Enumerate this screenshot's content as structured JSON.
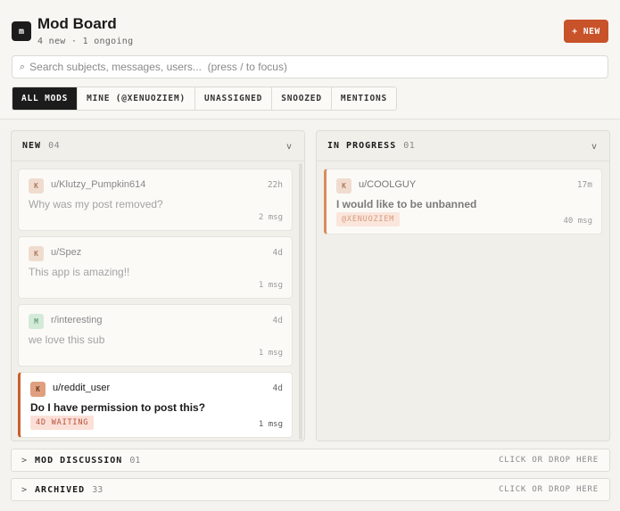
{
  "header": {
    "logo": "m",
    "title": "Mod Board",
    "subtitle": "4 new · 1 ongoing",
    "new_button": "+ NEW"
  },
  "search": {
    "icon": "search-icon",
    "placeholder": "Search subjects, messages, users...  (press / to focus)"
  },
  "filters": [
    "ALL MODS",
    "MINE (@XENUOZIEM)",
    "UNASSIGNED",
    "SNOOZED",
    "MENTIONS"
  ],
  "columns": {
    "new": {
      "title": "NEW",
      "count": "04",
      "chevron": "v",
      "cards": [
        {
          "avatar": "K",
          "author": "u/Klutzy_Pumpkin614",
          "age": "22h",
          "subject": "Why was my post removed?",
          "msgs": "2 msg"
        },
        {
          "avatar": "K",
          "author": "u/Spez",
          "age": "4d",
          "subject": "This app is amazing!!",
          "msgs": "1 msg"
        },
        {
          "avatar": "M",
          "author": "r/interesting",
          "age": "4d",
          "subject": "we love this sub",
          "msgs": "1 msg"
        },
        {
          "avatar": "K",
          "author": "u/reddit_user",
          "age": "4d",
          "subject": "Do I have permission to post this?",
          "msgs": "1 msg",
          "badge": "4D WAITING"
        }
      ]
    },
    "in_progress": {
      "title": "IN PROGRESS",
      "count": "01",
      "chevron": "v",
      "cards": [
        {
          "avatar": "K",
          "author": "u/COOLGUY",
          "age": "17m",
          "subject": "I would like to be unbanned",
          "msgs": "40 msg",
          "badge": "@XENUOZIEM"
        }
      ]
    }
  },
  "sections": [
    {
      "chevron": ">",
      "title": "MOD DISCUSSION",
      "count": "01",
      "hint": "CLICK OR DROP HERE"
    },
    {
      "chevron": ">",
      "title": "ARCHIVED",
      "count": "33",
      "hint": "CLICK OR DROP HERE"
    }
  ],
  "colors": {
    "accent": "#c8522a",
    "background": "#f4f3ef",
    "active_tab": "#1c1c1c"
  }
}
